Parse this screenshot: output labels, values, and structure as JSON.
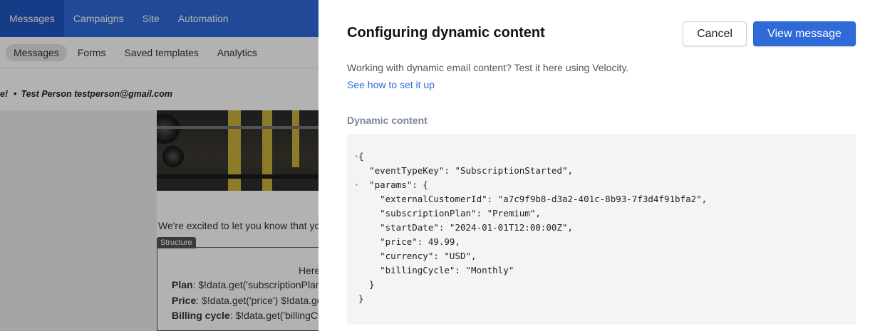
{
  "app": {
    "topnav": [
      "Messages",
      "Campaigns",
      "Site",
      "Automation"
    ],
    "subnav": [
      "Messages",
      "Forms",
      "Saved templates",
      "Analytics"
    ],
    "preview_prefix": "e!",
    "test_person": "Test Person testperson@gmail.com",
    "email": {
      "intro_text": "We're excited to let you know that yo",
      "structure_tag": "Structure",
      "here_text": "Here",
      "plan_label": "Plan",
      "plan_value": ": $!data.get('subscriptionPlan",
      "price_label": "Price",
      "price_value": ": $!data.get('price') $!data.ge",
      "billing_label": "Billing cycle",
      "billing_value": ": $!data.get('billingCy"
    }
  },
  "drawer": {
    "title": "Configuring dynamic content",
    "cancel_label": "Cancel",
    "view_label": "View message",
    "description": "Working with dynamic email content? Test it here using Velocity.",
    "link_text": "See how to set it up",
    "section_label": "Dynamic content",
    "code_lines": [
      "{",
      "  \"eventTypeKey\": \"SubscriptionStarted\",",
      "  \"params\": {",
      "    \"externalCustomerId\": \"a7c9f9b8-d3a2-401c-8b93-7f3d4f91bfa2\",",
      "    \"subscriptionPlan\": \"Premium\",",
      "    \"startDate\": \"2024-01-01T12:00:00Z\",",
      "    \"price\": 49.99,",
      "    \"currency\": \"USD\",",
      "    \"billingCycle\": \"Monthly\"",
      "  }",
      "}"
    ]
  },
  "colors": {
    "brand_blue": "#2f6bd8",
    "nav_active": "#1f56c0",
    "code_bg": "#f3f4f6"
  }
}
